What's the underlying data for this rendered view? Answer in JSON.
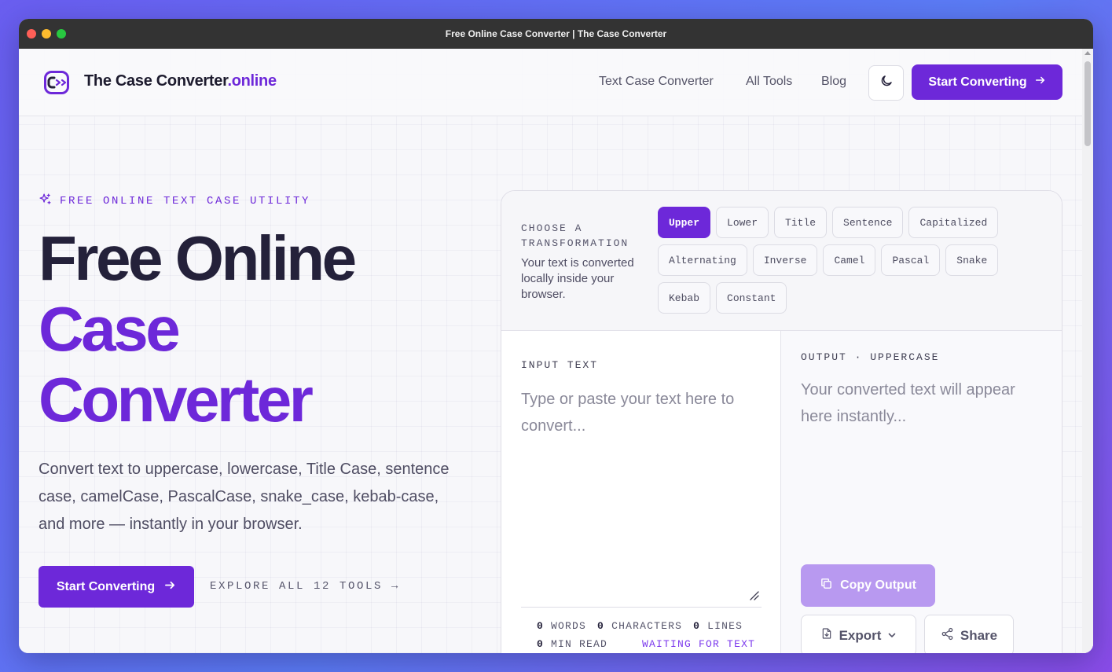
{
  "window": {
    "title": "Free Online Case Converter | The Case Converter"
  },
  "header": {
    "brand_main": "The Case Converter",
    "brand_tld": ".online",
    "nav": [
      "Text Case Converter",
      "All Tools",
      "Blog"
    ],
    "cta": "Start Converting"
  },
  "hero": {
    "eyebrow": "FREE ONLINE TEXT CASE UTILITY",
    "title_line1": "Free Online",
    "title_line2": "Case",
    "title_line3": "Converter",
    "lead": "Convert text to uppercase, lowercase, Title Case, sentence case, camelCase, PascalCase, snake_case, kebab-case, and more — instantly in your browser.",
    "cta": "Start Converting",
    "explore": "EXPLORE ALL 12 TOOLS →"
  },
  "tool": {
    "choose_label": "CHOOSE A TRANSFORMATION",
    "choose_note": "Your text is converted locally inside your browser.",
    "transformations": [
      "Upper",
      "Lower",
      "Title",
      "Sentence",
      "Capitalized",
      "Alternating",
      "Inverse",
      "Camel",
      "Pascal",
      "Snake",
      "Kebab",
      "Constant"
    ],
    "active_transformation": "Upper",
    "input_label": "INPUT TEXT",
    "input_placeholder": "Type or paste your text here to convert...",
    "input_value": "",
    "stats": {
      "words_count": "0",
      "words_label": "WORDS",
      "chars_count": "0",
      "chars_label": "CHARACTERS",
      "lines_count": "0",
      "lines_label": "LINES",
      "read_count": "0",
      "read_label": "MIN READ",
      "status": "WAITING FOR TEXT"
    },
    "output_label": "OUTPUT · UPPERCASE",
    "output_placeholder": "Your converted text will appear here instantly...",
    "copy": "Copy Output",
    "export": "Export",
    "share": "Share"
  },
  "colors": {
    "accent": "#6d28d9",
    "accent_soft": "#b899f0",
    "text_dark": "#24213a"
  },
  "icons": {
    "logo": "case-converter-logo-icon",
    "theme": "moon-icon",
    "eyebrow": "sparkles-icon",
    "cta": "arrow-right-icon",
    "copy": "copy-icon",
    "export": "file-download-icon",
    "share": "share-icon"
  }
}
